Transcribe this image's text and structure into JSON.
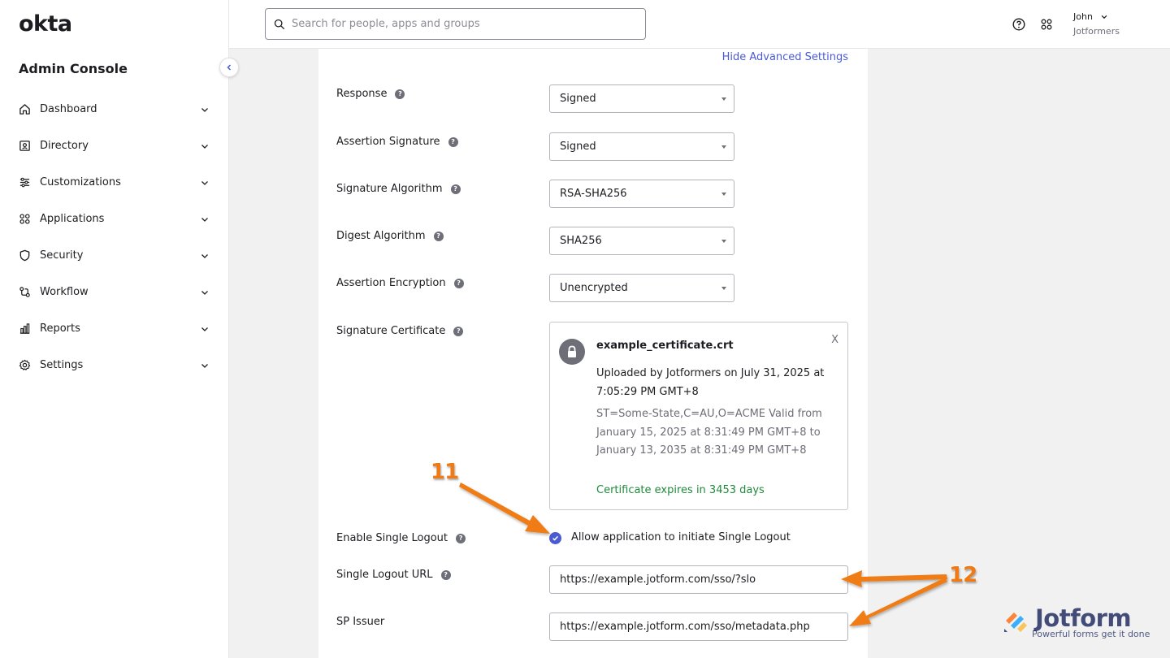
{
  "sidebar": {
    "logo": "okta",
    "title": "Admin Console",
    "items": [
      {
        "label": "Dashboard",
        "icon": "home-icon"
      },
      {
        "label": "Directory",
        "icon": "directory-icon"
      },
      {
        "label": "Customizations",
        "icon": "sliders-icon"
      },
      {
        "label": "Applications",
        "icon": "applications-icon"
      },
      {
        "label": "Security",
        "icon": "shield-icon"
      },
      {
        "label": "Workflow",
        "icon": "workflow-icon"
      },
      {
        "label": "Reports",
        "icon": "reports-icon"
      },
      {
        "label": "Settings",
        "icon": "gear-icon"
      }
    ]
  },
  "header": {
    "search_placeholder": "Search for people, apps and groups",
    "user_name": "John",
    "user_org": "Jotformers"
  },
  "form": {
    "advanced_link": "Hide Advanced Settings",
    "response": {
      "label": "Response",
      "value": "Signed"
    },
    "assertion_signature": {
      "label": "Assertion Signature",
      "value": "Signed"
    },
    "signature_algorithm": {
      "label": "Signature Algorithm",
      "value": "RSA-SHA256"
    },
    "digest_algorithm": {
      "label": "Digest Algorithm",
      "value": "SHA256"
    },
    "assertion_encryption": {
      "label": "Assertion Encryption",
      "value": "Unencrypted"
    },
    "signature_certificate": {
      "label": "Signature Certificate",
      "close": "X",
      "file_name": "example_certificate.crt",
      "uploaded": "Uploaded by Jotformers on July 31, 2025 at 7:05:29 PM GMT+8",
      "details": "ST=Some-State,C=AU,O=ACME Valid from January 15, 2025 at 8:31:49 PM GMT+8 to January 13, 2035 at 8:31:49 PM GMT+8",
      "expiry": "Certificate expires in 3453 days"
    },
    "single_logout": {
      "label": "Enable Single Logout",
      "checkbox_label": "Allow application to initiate Single Logout",
      "checked": true
    },
    "single_logout_url": {
      "label": "Single Logout URL",
      "value": "https://example.jotform.com/sso/?slo"
    },
    "sp_issuer": {
      "label": "SP Issuer",
      "value": "https://example.jotform.com/sso/metadata.php"
    }
  },
  "annotations": {
    "step_11": "11",
    "step_12": "12",
    "color": "#f07b16"
  },
  "watermark": {
    "brand": "Jotform",
    "tagline": "Powerful forms get it done"
  },
  "colors": {
    "accent": "#4a5bd1",
    "success": "#1f8a3c",
    "annotation": "#f07b16"
  }
}
